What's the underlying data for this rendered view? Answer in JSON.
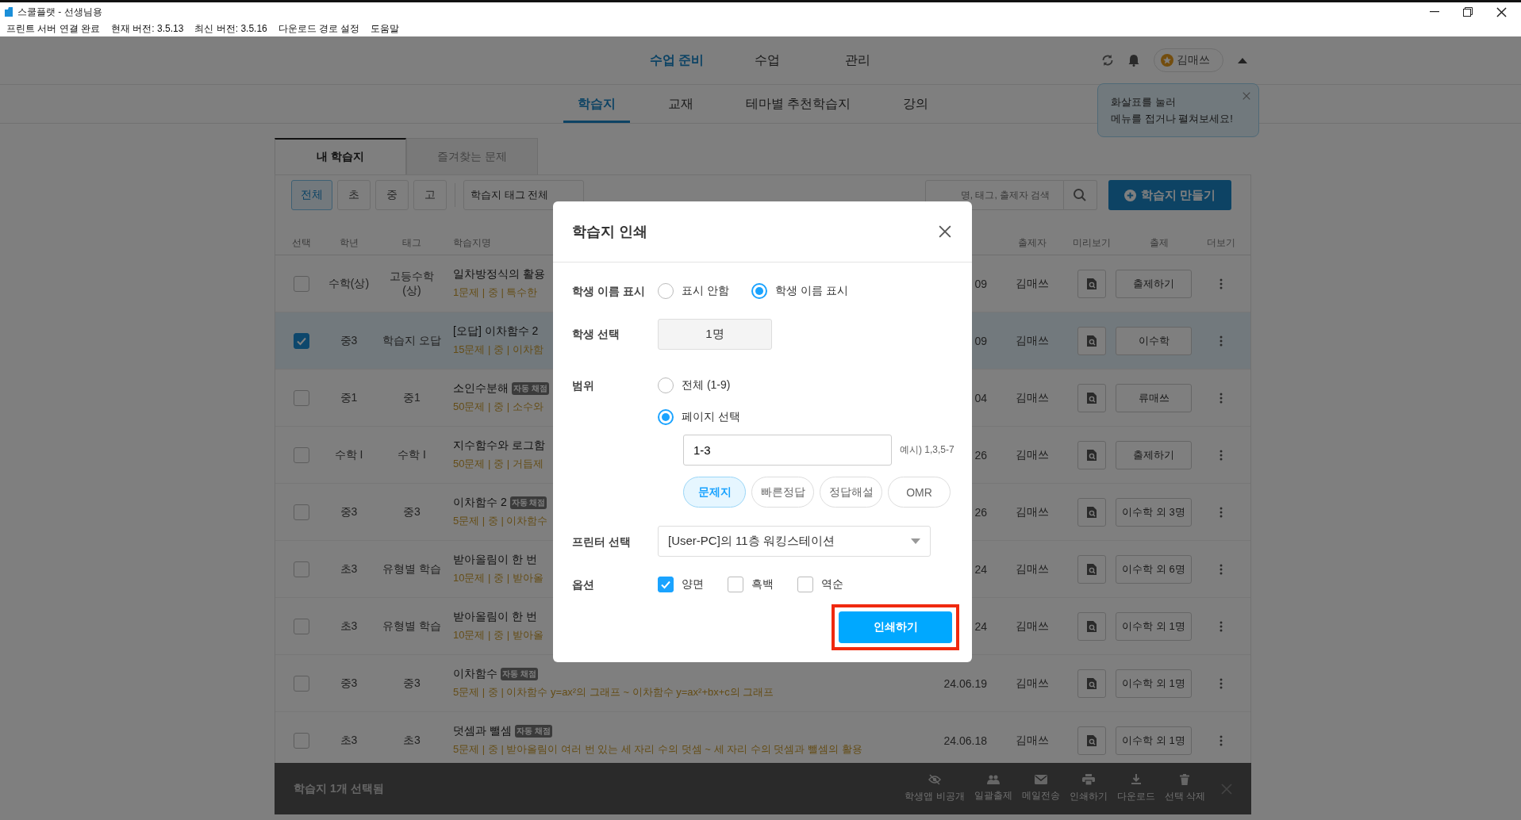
{
  "window": {
    "title": "스쿨플랫 - 선생님용"
  },
  "menu_bar": [
    "프린트 서버 연결 완료",
    "현재 버전: 3.5.13",
    "최신 버전: 3.5.16",
    "다운로드 경로 설정",
    "도움말"
  ],
  "top_nav": [
    {
      "label": "수업 준비",
      "selected": true
    },
    {
      "label": "수업",
      "selected": false
    },
    {
      "label": "관리",
      "selected": false
    }
  ],
  "user": {
    "name": "김매쓰"
  },
  "sub_nav": [
    {
      "label": "학습지",
      "selected": true
    },
    {
      "label": "교재",
      "selected": false
    },
    {
      "label": "테마별 추천학습지",
      "selected": false
    },
    {
      "label": "강의",
      "selected": false
    }
  ],
  "tooltip": {
    "lines": [
      "화살표를 눌러",
      "메뉴를 접거나 펼쳐보세요!"
    ]
  },
  "content_tabs": [
    {
      "label": "내 학습지",
      "selected": true
    },
    {
      "label": "즐겨찾는 문제",
      "selected": false
    }
  ],
  "filters": [
    {
      "label": "전체",
      "selected": true
    },
    {
      "label": "초",
      "selected": false
    },
    {
      "label": "중",
      "selected": false
    },
    {
      "label": "고",
      "selected": false
    }
  ],
  "tag_filter": {
    "value": "학습지 태그 전체"
  },
  "search": {
    "placeholder": "명, 태그, 출제자 검색"
  },
  "create_button": {
    "label": "학습지 만들기"
  },
  "table": {
    "columns": [
      "선택",
      "학년",
      "태그",
      "학습지명",
      "출제자",
      "미리보기",
      "출제",
      "더보기"
    ],
    "rows": [
      {
        "grade": "수학(상)",
        "tag": "고등수학\n(상)",
        "title": "일차방정식의 활용",
        "summary": "1문제 | 중 | 특수한",
        "date": "09",
        "author": "김매쓰",
        "assign": "출제하기",
        "selected": false
      },
      {
        "grade": "중3",
        "tag": "학습지 오답",
        "title": "[오답] 이차함수 2",
        "summary": "15문제 | 중 | 이차함",
        "date": "09",
        "author": "김매쓰",
        "assign": "이수학",
        "selected": true
      },
      {
        "grade": "중1",
        "tag": "중1",
        "title": "소인수분해",
        "badge": "자동 채점",
        "summary": "50문제 | 중 | 소수와",
        "date": "04",
        "author": "김매쓰",
        "assign": "류매쓰",
        "selected": false
      },
      {
        "grade": "수학 I",
        "tag": "수학 I",
        "title": "지수함수와 로그함",
        "summary": "50문제 | 중 | 거듭제",
        "date": "26",
        "author": "김매쓰",
        "assign": "출제하기",
        "selected": false
      },
      {
        "grade": "중3",
        "tag": "중3",
        "title": "이차함수 2",
        "badge": "자동 채점",
        "summary": "5문제 | 중 | 이차함수",
        "date": "26",
        "author": "김매쓰",
        "assign": "이수학 외 3명",
        "selected": false
      },
      {
        "grade": "초3",
        "tag": "유형별 학습",
        "title": "받아올림이 한 번",
        "summary": "10문제 | 중 | 받아올",
        "date": "24",
        "author": "김매쓰",
        "assign": "이수학 외 6명",
        "selected": false
      },
      {
        "grade": "초3",
        "tag": "유형별 학습",
        "title": "받아올림이 한 번",
        "summary": "10문제 | 중 | 받아올",
        "date": "24",
        "author": "김매쓰",
        "assign": "이수학 외 1명",
        "selected": false
      },
      {
        "grade": "중3",
        "tag": "중3",
        "title": "이차함수",
        "badge": "자동 채점",
        "summary": "5문제 | 중 | 이차함수 y=ax²의 그래프 ~ 이차함수 y=ax²+bx+c의 그래프",
        "date": "24.06.19",
        "author": "김매쓰",
        "assign": "이수학 외 1명",
        "selected": false
      },
      {
        "grade": "초3",
        "tag": "초3",
        "title": "덧셈과 뺄셈",
        "badge": "자동 채점",
        "summary": "5문제 | 중 | 받아올림이 여러 번 있는 세 자리 수의 덧셈 ~ 세 자리 수의 덧셈과 뺄셈의 활용",
        "date": "24.06.18",
        "author": "김매쓰",
        "assign": "이수학 외 1명",
        "selected": false
      }
    ]
  },
  "selection_bar": {
    "text": "학습지 1개 선택됨",
    "actions": [
      "학생앱 비공개",
      "일괄출제",
      "메일전송",
      "인쇄하기",
      "다운로드",
      "선택 삭제"
    ]
  },
  "dialog": {
    "title": "학습지 인쇄",
    "name_display": {
      "label": "학생 이름 표시",
      "options": [
        {
          "label": "표시 안함",
          "selected": false
        },
        {
          "label": "학생 이름 표시",
          "selected": true
        }
      ]
    },
    "student_select": {
      "label": "학생 선택",
      "value": "1명"
    },
    "range": {
      "label": "범위",
      "options": [
        {
          "label": "전체 (1-9)",
          "selected": false
        },
        {
          "label": "페이지 선택",
          "selected": true
        }
      ],
      "pages": {
        "value": "1-3",
        "hint": "예시) 1,3,5-7"
      },
      "types": [
        {
          "label": "문제지",
          "selected": true
        },
        {
          "label": "빠른정답",
          "selected": false
        },
        {
          "label": "정답해설",
          "selected": false
        },
        {
          "label": "OMR",
          "selected": false
        }
      ]
    },
    "printer": {
      "label": "프린터 선택",
      "value": "[User-PC]의 11층 워킹스테이션"
    },
    "options": {
      "label": "옵션",
      "items": [
        {
          "label": "양면",
          "checked": true
        },
        {
          "label": "흑백",
          "checked": false
        },
        {
          "label": "역순",
          "checked": false
        }
      ]
    },
    "print_button": {
      "label": "인쇄하기",
      "highlighted": true
    }
  }
}
